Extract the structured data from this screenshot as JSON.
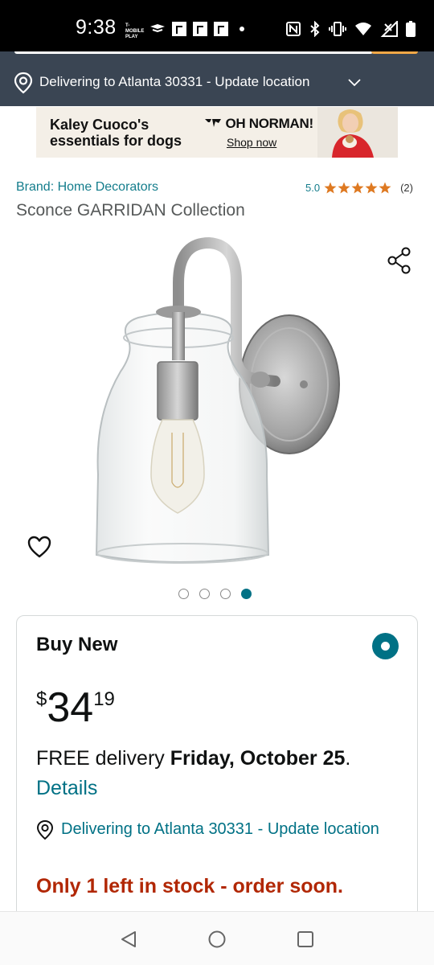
{
  "status_bar": {
    "time": "9:38",
    "carrier": "T-MOBILE PLAY",
    "icons": [
      "nfc-icon",
      "bluetooth-icon",
      "vibrate-icon",
      "wifi-icon",
      "signal-icon",
      "battery-icon"
    ]
  },
  "delivery_bar": {
    "text": "Delivering to Atlanta 30331 - Update location"
  },
  "ad": {
    "headline_line1": "Kaley Cuoco's",
    "headline_line2": "essentials for dogs",
    "brand": "OH NORMAN!",
    "cta": "Shop now"
  },
  "product": {
    "brand": "Brand: Home Decorators",
    "rating": "5.0",
    "rating_stars": 5,
    "rating_count": "(2)",
    "title": "Sconce GARRIDAN Collection",
    "image_count": 4,
    "active_image_index": 3
  },
  "buy_box": {
    "title": "Buy New",
    "price_symbol": "$",
    "price_whole": "34",
    "price_fraction": "19",
    "delivery_prefix": "FREE delivery ",
    "delivery_date": "Friday, October 25",
    "delivery_suffix": ".",
    "details_label": "Details",
    "location_text": "Delivering to Atlanta 30331 - Update location",
    "stock_text": "Only 1 left in stock - order soon."
  },
  "colors": {
    "header_bg": "#3a4553",
    "link": "#007185",
    "stock_red": "#b12704",
    "star": "#de7921"
  }
}
